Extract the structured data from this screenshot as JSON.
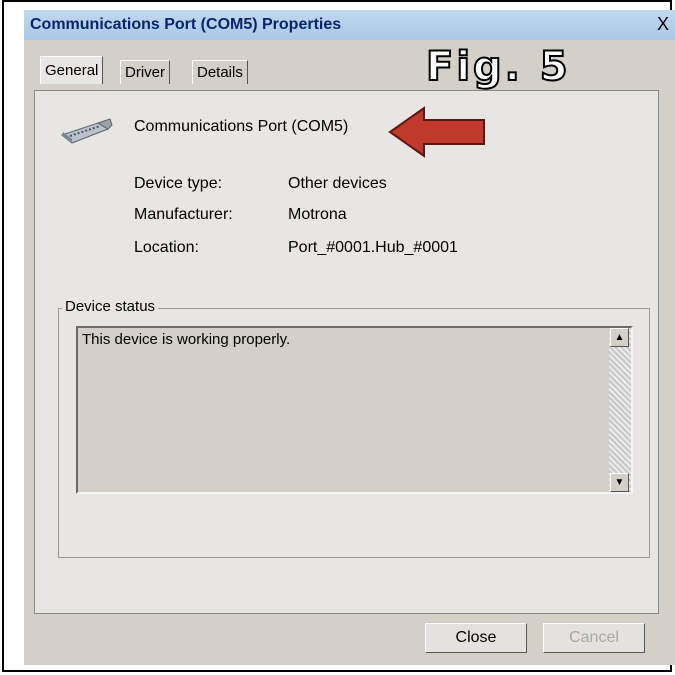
{
  "window": {
    "title": "Communications Port (COM5) Properties",
    "close_glyph": "X"
  },
  "tabs": [
    {
      "label": "General",
      "active": true
    },
    {
      "label": "Driver",
      "active": false
    },
    {
      "label": "Details",
      "active": false
    }
  ],
  "annotation": {
    "figure_label": "Fig. 5",
    "arrow_color": "#c0392b"
  },
  "device": {
    "icon": "serial-port-icon",
    "name": "Communications Port (COM5)",
    "properties": [
      {
        "label": "Device type:",
        "value": "Other devices"
      },
      {
        "label": "Manufacturer:",
        "value": "Motrona"
      },
      {
        "label": "Location:",
        "value": "Port_#0001.Hub_#0001"
      }
    ]
  },
  "status": {
    "group_label": "Device status",
    "text": "This device is working properly."
  },
  "buttons": {
    "close": "Close",
    "cancel": "Cancel"
  }
}
